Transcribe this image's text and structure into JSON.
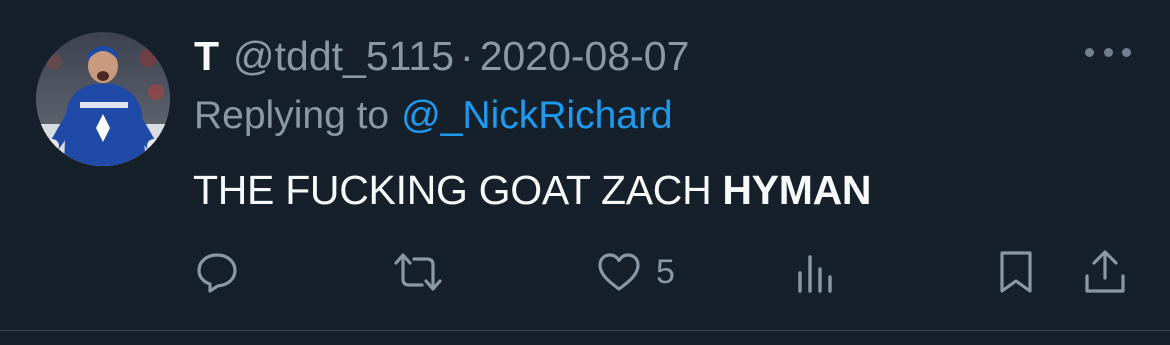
{
  "tweet": {
    "display_name": "T",
    "handle": "@tddt_5115",
    "separator": "·",
    "date": "2020-08-07",
    "replying_prefix": "Replying to",
    "replying_to": "@_NickRichard",
    "text_regular": "THE FUCKING GOAT ZACH",
    "text_bold": "HYMAN",
    "like_count": "5"
  },
  "actions": {
    "icons": [
      "reply-icon",
      "retweet-icon",
      "like-icon",
      "views-icon",
      "bookmark-icon",
      "share-icon"
    ]
  },
  "colors": {
    "background": "#15202b",
    "text_primary": "#f7f9f9",
    "text_secondary": "#8b98a5",
    "link": "#1d9bf0",
    "icon": "#8b98a5",
    "divider": "#38444d"
  }
}
